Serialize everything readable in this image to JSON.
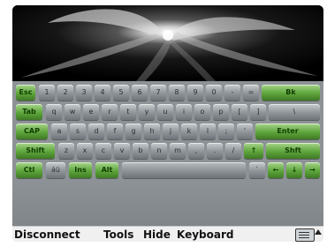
{
  "wallpaper": {
    "description_icon": "swirl-wallpaper"
  },
  "keyboard": {
    "rows": [
      [
        "Esc",
        "1",
        "2",
        "3",
        "4",
        "5",
        "6",
        "7",
        "8",
        "9",
        "0",
        "-",
        "=",
        "Bk"
      ],
      [
        "Tab",
        "q",
        "w",
        "e",
        "r",
        "t",
        "y",
        "u",
        "i",
        "o",
        "p",
        "[",
        "]",
        "\\"
      ],
      [
        "CAP",
        "a",
        "s",
        "d",
        "f",
        "g",
        "h",
        "j",
        "k",
        "l",
        ";",
        "'",
        "Enter"
      ],
      [
        "Shift",
        "z",
        "x",
        "c",
        "v",
        "b",
        "n",
        "m",
        ",",
        ".",
        "/",
        "↑",
        "Shft"
      ],
      [
        "Ctl",
        "áü",
        "Ins",
        "Alt",
        "",
        "",
        "`",
        "←",
        "↓",
        "→"
      ]
    ]
  },
  "taskbar": {
    "disconnect": "Disconnect",
    "tools": "Tools",
    "hide": "Hide",
    "keyboard": "Keyboard"
  },
  "colors": {
    "accent": "#5ea53c",
    "key": "#8e9498",
    "panel": "#8d9296"
  },
  "icons": {
    "keyboard_icon": "keyboard-icon",
    "menu_arrow": "up-arrow-icon"
  }
}
